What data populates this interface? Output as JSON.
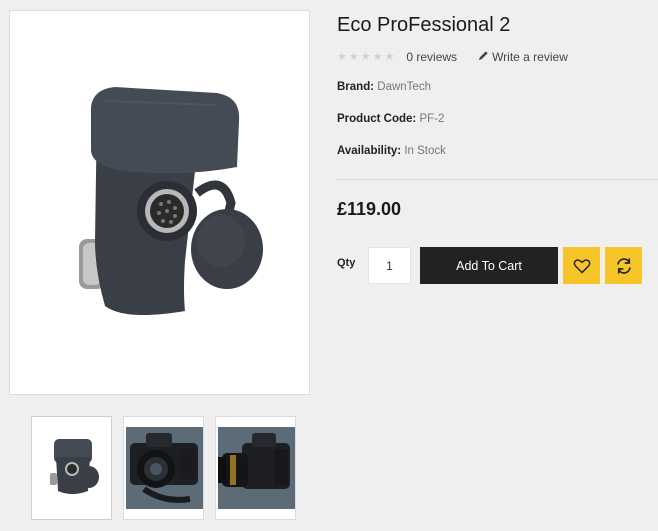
{
  "product": {
    "title": "Eco ProFessional 2",
    "reviews_count": "0 reviews",
    "write_review": "Write a review",
    "rating": 0,
    "rating_max": 5,
    "brand_label": "Brand:",
    "brand_value": "DawnTech",
    "code_label": "Product Code:",
    "code_value": "PF-2",
    "availability_label": "Availability:",
    "availability_value": "In Stock",
    "price": "£119.00"
  },
  "purchase": {
    "qty_label": "Qty",
    "qty_value": "1",
    "add_to_cart": "Add To Cart",
    "wishlist_icon": "heart-icon",
    "compare_icon": "refresh-icon"
  },
  "gallery": {
    "main": "product-main-image",
    "thumbs": [
      "thumb-adapter",
      "thumb-camera-front",
      "thumb-camera-side"
    ]
  },
  "colors": {
    "accent": "#f6c52a",
    "cart_button": "#222222",
    "background": "#efefef"
  }
}
